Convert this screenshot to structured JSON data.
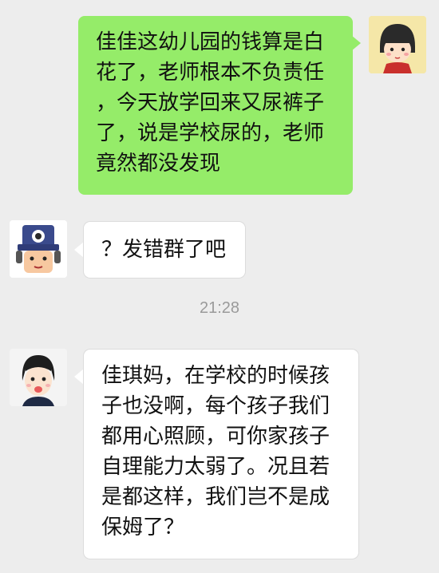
{
  "conversation": {
    "messages": [
      {
        "sender": "self",
        "avatar_icon": "cartoon-girl-avatar-icon",
        "lines": [
          "佳佳这幼儿园的钱算是白",
          "花了，老师根本不负责任",
          "，今天放学回来又尿裤子",
          "了，说是学校尿的，老师",
          "竟然都没发现"
        ]
      },
      {
        "sender": "other",
        "avatar_icon": "robot-avatar-icon",
        "lines": [
          "？发错群了吧"
        ]
      },
      {
        "sender": "other",
        "avatar_icon": "cartoon-boy-avatar-icon",
        "lines": [
          "佳琪妈，在学校的时候孩",
          "子也没啊，每个孩子我们",
          "都用心照顾，可你家孩子",
          "自理能力太弱了。况且若",
          "是都这样，我们岂不是成",
          "保姆了？"
        ]
      }
    ],
    "timestamp": "21:28"
  },
  "colors": {
    "background": "#ededed",
    "self_bubble": "#95ec69",
    "other_bubble": "#ffffff",
    "timestamp_text": "#9a9a9a"
  }
}
